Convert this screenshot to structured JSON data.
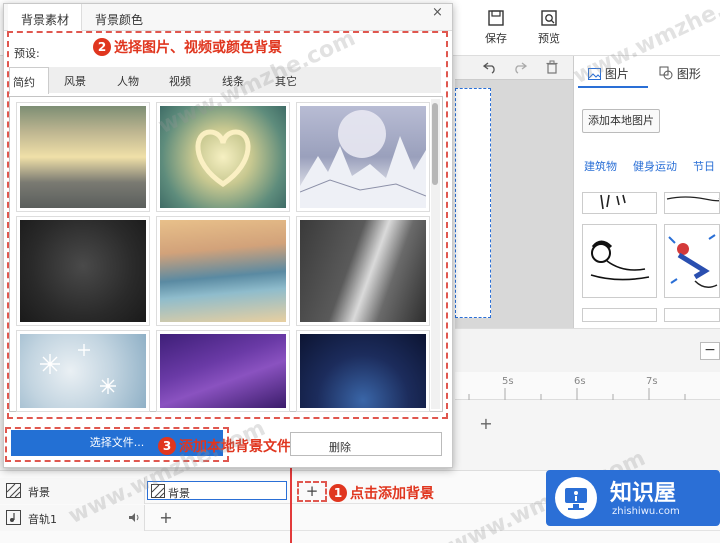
{
  "toolbar": {
    "save_label": "保存",
    "preview_label": "预览"
  },
  "dialog": {
    "tabs": [
      "背景素材",
      "背景颜色"
    ],
    "close": "×",
    "preset_label": "预设:",
    "subtabs": [
      "简约",
      "风景",
      "人物",
      "视频",
      "线条",
      "其它"
    ],
    "select_file": "选择文件...",
    "delete": "删除"
  },
  "right_panel": {
    "tab_image": "图片",
    "tab_shape": "图形",
    "add_local_image": "添加本地图片",
    "categories": [
      "建筑物",
      "健身运动",
      "节日"
    ]
  },
  "timeline": {
    "ticks": [
      "5s",
      "6s",
      "7s"
    ],
    "track_bg_label": "背景",
    "track_bg_clip": "背景",
    "track_audio_label": "音轨1",
    "add_plus": "+"
  },
  "callouts": {
    "c1": "点击添加背景",
    "c2": "选择图片、视频或颜色背景",
    "c3": "添加本地背景文件",
    "n1": "1",
    "n2": "2",
    "n3": "3"
  },
  "watermarks": [
    "www.wmzhe.com",
    "www.wmzhe.com",
    "www.wmzhe.com",
    "www.wmzhe.com"
  ],
  "logo": {
    "title": "知识屋",
    "url": "zhishiwu.com"
  },
  "colors": {
    "accent": "#2370d4",
    "callout": "#e0361f",
    "playhead": "#e23a3a"
  }
}
